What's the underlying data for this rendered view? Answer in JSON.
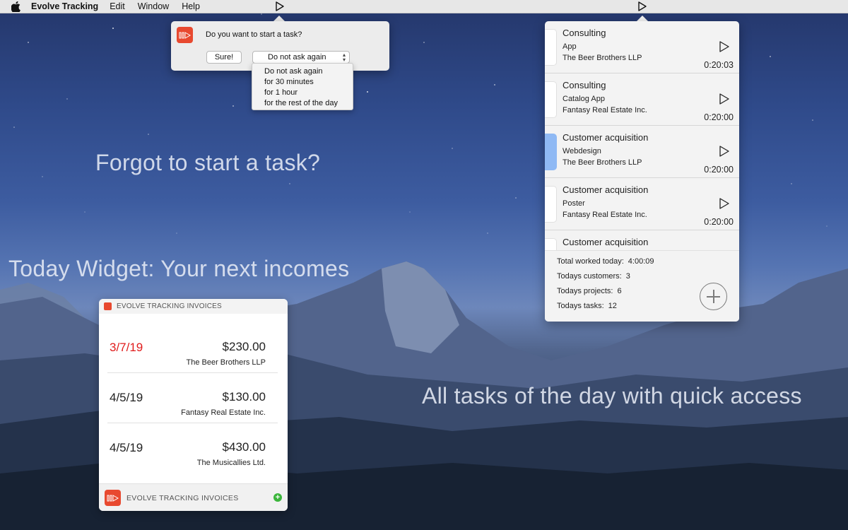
{
  "menubar": {
    "app_name": "Evolve Tracking",
    "menus": [
      "Edit",
      "Window",
      "Help"
    ],
    "icons": [
      "apple-logo-icon",
      "play-icon",
      "play-icon"
    ]
  },
  "prompt": {
    "question": "Do you want to start a task?",
    "sure_label": "Sure!",
    "select_value": "Do not ask again",
    "options": [
      "Do not ask again",
      "for 30 minutes",
      "for 1 hour",
      "for the rest of the day"
    ]
  },
  "captions": {
    "forgot": "Forgot to start a task?",
    "widget": "Today Widget: Your next incomes",
    "tasks": "All tasks of the day with quick access"
  },
  "widget": {
    "header_title": "EVOLVE TRACKING INVOICES",
    "invoices": [
      {
        "date": "3/7/19",
        "amount": "$230.00",
        "client": "The Beer Brothers LLP",
        "overdue": true
      },
      {
        "date": "4/5/19",
        "amount": "$130.00",
        "client": "Fantasy Real Estate Inc.",
        "overdue": false
      },
      {
        "date": "4/5/19",
        "amount": "$430.00",
        "client": "The Musicallies Ltd.",
        "overdue": false
      }
    ],
    "footer_title": "EVOLVE TRACKING INVOICES",
    "overdue_color": "#e01b1b",
    "add_color": "#3bb53b"
  },
  "tasks": {
    "items": [
      {
        "name": "Consulting",
        "project": "App",
        "client": "The Beer Brothers LLP",
        "time": "0:20:03",
        "active": false
      },
      {
        "name": "Consulting",
        "project": "Catalog App",
        "client": "Fantasy Real Estate Inc.",
        "time": "0:20:00",
        "active": false
      },
      {
        "name": "Customer acquisition",
        "project": "Webdesign",
        "client": "The Beer Brothers LLP",
        "time": "0:20:00",
        "active": true
      },
      {
        "name": "Customer acquisition",
        "project": "Poster",
        "client": "Fantasy Real Estate Inc.",
        "time": "0:20:00",
        "active": false
      },
      {
        "name": "Customer acquisition",
        "project": "",
        "client": "",
        "time": "",
        "active": false
      }
    ],
    "active_color": "#8fb9f4",
    "summary": {
      "worked_label": "Total worked today:",
      "worked_value": "4:00:09",
      "customers_label": "Todays customers:",
      "customers_value": "3",
      "projects_label": "Todays projects:",
      "projects_value": "6",
      "tasks_label": "Todays tasks:",
      "tasks_value": "12"
    }
  },
  "brand_color": "#e8492f"
}
